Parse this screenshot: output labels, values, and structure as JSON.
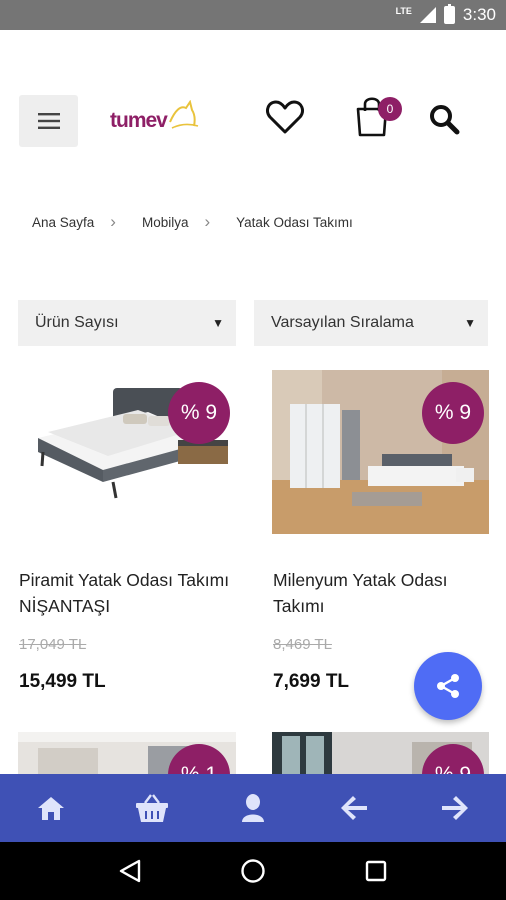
{
  "status_bar": {
    "network": "LTE",
    "battery": "",
    "time": "3:30"
  },
  "header": {
    "logo_text": "tumev",
    "cart_count": "0",
    "icons": [
      "menu-icon",
      "heart-icon",
      "cart-icon",
      "search-icon"
    ]
  },
  "breadcrumb": [
    "Ana Sayfa",
    "Mobilya",
    "Yatak Odası Takımı"
  ],
  "filters": {
    "count_label": "Ürün Sayısı",
    "sort_label": "Varsayılan Sıralama"
  },
  "products": [
    {
      "discount": "% 9",
      "name": "Piramit Yatak Odası Takımı NİŞANTAŞI",
      "old_price": "17,049 TL",
      "price": "15,499 TL"
    },
    {
      "discount": "% 9",
      "name": "Milenyum Yatak Odası Takımı",
      "old_price": "8,469 TL",
      "price": "7,699 TL"
    },
    {
      "discount": "% 1"
    },
    {
      "discount": "% 9"
    }
  ],
  "bottom_nav": [
    "home-icon",
    "basket-icon",
    "user-icon",
    "back-arrow-icon",
    "forward-arrow-icon"
  ],
  "colors": {
    "accent": "#8e1f66",
    "bar": "#3f51b5",
    "fab": "#4f6cf5"
  }
}
